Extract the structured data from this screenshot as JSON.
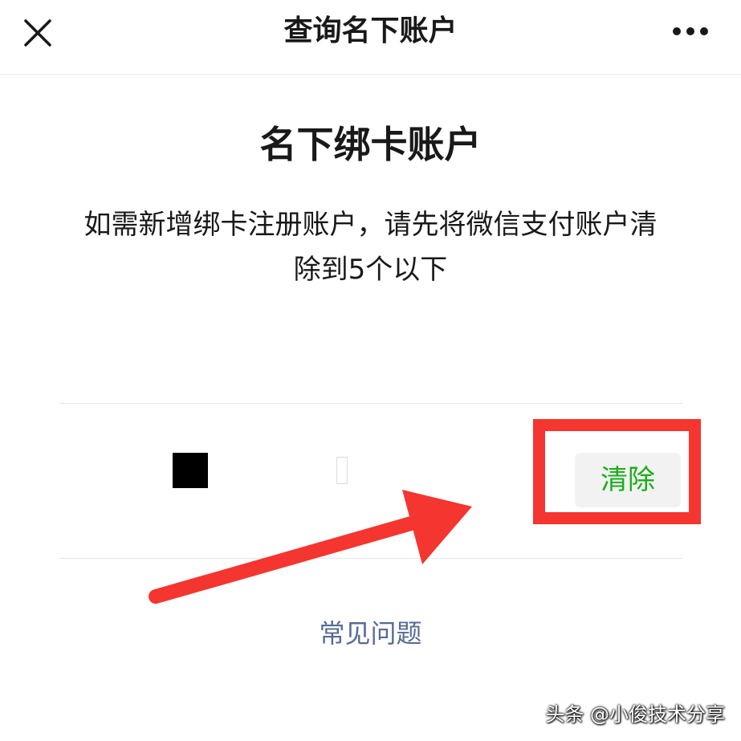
{
  "navbar": {
    "title": "查询名下账户",
    "close_icon": "close-icon",
    "more_icon": "more-icon"
  },
  "main": {
    "heading": "名下绑卡账户",
    "description": "如需新增绑卡注册账户，请先将微信支付账户清除到5个以下"
  },
  "account": {
    "clear_label": "清除"
  },
  "faq": {
    "label": "常见问题"
  },
  "watermark": "头条 @小俊技术分享",
  "colors": {
    "accent_green": "#1aad19",
    "link_blue": "#576b95",
    "annotation_red": "#f43530"
  }
}
